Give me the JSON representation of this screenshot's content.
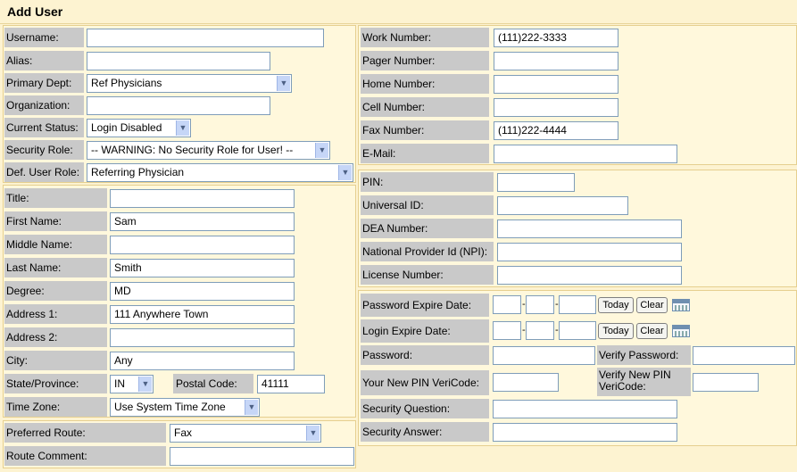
{
  "title": "Add User",
  "account": {
    "username_label": "Username:",
    "username_value": "",
    "alias_label": "Alias:",
    "alias_value": "",
    "primary_dept_label": "Primary Dept:",
    "primary_dept_value": "Ref Physicians",
    "organization_label": "Organization:",
    "organization_value": "",
    "current_status_label": "Current Status:",
    "current_status_value": "Login Disabled",
    "security_role_label": "Security Role:",
    "security_role_value": "-- WARNING: No Security Role for User! --",
    "def_user_role_label": "Def. User Role:",
    "def_user_role_value": "Referring Physician"
  },
  "personal": {
    "title_label": "Title:",
    "title_value": "",
    "first_name_label": "First Name:",
    "first_name_value": "Sam",
    "middle_name_label": "Middle Name:",
    "middle_name_value": "",
    "last_name_label": "Last Name:",
    "last_name_value": "Smith",
    "degree_label": "Degree:",
    "degree_value": "MD",
    "address1_label": "Address 1:",
    "address1_value": "111 Anywhere Town",
    "address2_label": "Address 2:",
    "address2_value": "",
    "city_label": "City:",
    "city_value": "Any",
    "state_label": "State/Province:",
    "state_value": "IN",
    "postal_label": "Postal Code:",
    "postal_value": "41111",
    "timezone_label": "Time Zone:",
    "timezone_value": "Use System Time Zone"
  },
  "route": {
    "preferred_label": "Preferred Route:",
    "preferred_value": "Fax",
    "comment_label": "Route Comment:",
    "comment_value": ""
  },
  "contact": {
    "work_label": "Work Number:",
    "work_value": "(111)222-3333",
    "pager_label": "Pager Number:",
    "pager_value": "",
    "home_label": "Home Number:",
    "home_value": "",
    "cell_label": "Cell Number:",
    "cell_value": "",
    "fax_label": "Fax Number:",
    "fax_value": "(111)222-4444",
    "email_label": "E-Mail:",
    "email_value": ""
  },
  "ids": {
    "pin_label": "PIN:",
    "pin_value": "",
    "universal_label": "Universal ID:",
    "universal_value": "",
    "dea_label": "DEA Number:",
    "dea_value": "",
    "npi_label": "National Provider Id (NPI):",
    "npi_value": "",
    "license_label": "License Number:",
    "license_value": ""
  },
  "security": {
    "pwd_expire_label": "Password Expire Date:",
    "login_expire_label": "Login Expire Date:",
    "today_label": "Today",
    "clear_label": "Clear",
    "password_label": "Password:",
    "password_value": "",
    "verify_password_label": "Verify Password:",
    "verify_password_value": "",
    "pin_verify_label": "Your New PIN VeriCode:",
    "pin_verify_value": "",
    "verify_pin_label": "Verify New PIN VeriCode:",
    "verify_pin_value": "",
    "question_label": "Security Question:",
    "question_value": "",
    "answer_label": "Security Answer:",
    "answer_value": ""
  },
  "icons": {
    "dropdown": "chevron-down-icon",
    "calendar": "calendar-icon"
  }
}
